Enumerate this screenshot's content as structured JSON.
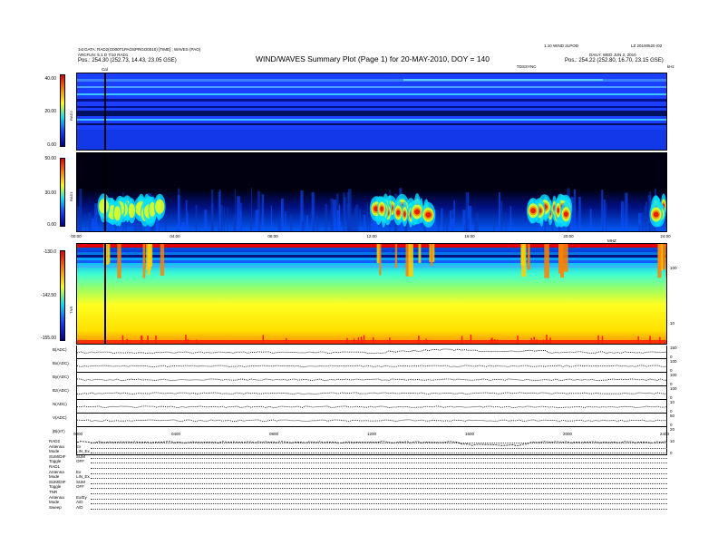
{
  "header": {
    "left_line1": "1st DATA: RAD2(G000T1PAOSPRGO0010) [TIME]  ; WAVES (PAO)",
    "left_line2": "ARCFUN: 5.1 D 7/10 RAD1",
    "left_line3": "Pos.:   254.30 (252.73, 14.43, 23.05 GSE)",
    "title": "WIND/WAVES Summary Plot (Page 1) for 20-MAY-2010, DOY = 140",
    "right_line1": "1.10 WIND 2LPOD",
    "right_line2": "LZ 20100520 r02",
    "right_line3": "DAILY: WED JUN 2, 2010",
    "right_line4": "Pos.:   254.22 (252.80, 16.70, 23.15 GSE)",
    "cal_label": "Cal",
    "tnr_sync_label": "TDSSYNC",
    "freq_units": "kHz",
    "minor_label": "MHZ"
  },
  "colors": {
    "deep": "#00008b",
    "blue": "#1040ff",
    "cyan": "#00e0ff",
    "yellow": "#ffff00",
    "orange": "#ff8000",
    "red": "#e00000"
  },
  "chart_data": [
    {
      "type": "heatmap",
      "name": "RAD2",
      "ylabel": "RAD2",
      "yticks": [
        "40.00",
        "20.00",
        "0.00"
      ],
      "ylim": [
        0,
        40
      ],
      "colorbar_range": [
        0,
        40
      ],
      "description_intensity": "mostly low background with narrow-band interference lines"
    },
    {
      "type": "heatmap",
      "name": "RAD1",
      "ylabel": "RAD1",
      "yticks": [
        "50.00",
        "30.00",
        "0.00"
      ],
      "ylim": [
        0,
        50
      ],
      "colorbar_range": [
        0,
        50
      ],
      "xticks": [
        "00:00",
        "04:00",
        "08:00",
        "12:00",
        "16:00",
        "20:00",
        "24:00"
      ],
      "bursts_hours": [
        [
          1,
          3.5
        ],
        [
          12,
          14.5
        ],
        [
          18,
          20
        ],
        [
          23.5,
          24
        ]
      ]
    },
    {
      "type": "heatmap",
      "name": "TNR",
      "ylabel": "TNR",
      "yticks": [
        "-130.0",
        "-142.50",
        "-155.00"
      ],
      "ylim": [
        -155,
        -130
      ],
      "right_ticks": [
        "100",
        "10"
      ],
      "colorbar_range": [
        -155,
        -130
      ]
    },
    {
      "type": "line",
      "name": "MFI/SWE traces",
      "rows": [
        {
          "label": "B(ADC)",
          "right": [
            "150",
            "0"
          ]
        },
        {
          "label": "Bx(ADC)",
          "right": [
            "100",
            "0"
          ]
        },
        {
          "label": "By(ADC)",
          "right": [
            "100",
            "0"
          ]
        },
        {
          "label": "Bz(ADC)",
          "right": [
            "100",
            "0"
          ]
        },
        {
          "label": "N(ADC)",
          "right": [
            "10",
            "0"
          ]
        },
        {
          "label": "V(ADC)",
          "right": [
            "50",
            "0"
          ]
        },
        {
          "label": "|B|(nT)",
          "right": [
            "20",
            "10",
            "0"
          ]
        }
      ],
      "xticks": [
        "0000",
        "0400",
        "0800",
        "1200",
        "1600",
        "2000",
        "2400"
      ]
    }
  ],
  "footer": {
    "rows": [
      {
        "k": "RAD2",
        "v": ""
      },
      {
        "k": "Antenna",
        "v": "Ex"
      },
      {
        "k": "Mode",
        "v": "LIN_Ex"
      },
      {
        "k": "SUM/DIF",
        "v": "SUM"
      },
      {
        "k": "Toggle",
        "v": "OFF"
      },
      {
        "k": "RAD1",
        "v": ""
      },
      {
        "k": "Antenna",
        "v": "Ex"
      },
      {
        "k": "Mode",
        "v": "LIN_Ex"
      },
      {
        "k": "SUM/DIF",
        "v": "SUM"
      },
      {
        "k": "Toggle",
        "v": "OFF"
      },
      {
        "k": "TNR",
        "v": ""
      },
      {
        "k": "Antenna",
        "v": "Ex/Ey"
      },
      {
        "k": "Mode",
        "v": "A/D"
      },
      {
        "k": "Sweep",
        "v": "A/D"
      }
    ]
  }
}
